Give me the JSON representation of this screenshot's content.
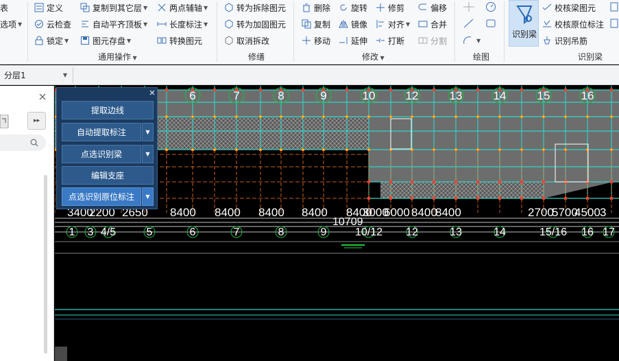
{
  "ribbon": {
    "col0": {
      "item1": "表",
      "item2": "选项"
    },
    "common_ops": {
      "define": "定义",
      "copy_to_other_layer": "复制到其它层",
      "two_point_axis": "两点辅轴",
      "cloud_check": "云检查",
      "auto_align_slab": "自动平齐顶板",
      "length_dim": "长度标注",
      "lock": "锁定",
      "element_save": "图元存盘",
      "convert_element": "转换图元",
      "group_label": "通用操作"
    },
    "repair": {
      "to_demolish": "转为拆除图元",
      "to_reinforce": "转为加固图元",
      "cancel_demolish": "取消拆改",
      "group_label": "修缮"
    },
    "modify": {
      "delete": "删除",
      "rotate": "旋转",
      "trim": "修剪",
      "offset": "偏移",
      "copy": "复制",
      "mirror": "镜像",
      "align": "对齐",
      "merge": "合并",
      "move": "移动",
      "extend": "延伸",
      "break": "打断",
      "split": "分割",
      "group_label": "修改"
    },
    "draw": {
      "group_label": "绘图"
    },
    "recognize_beam": {
      "main_label": "识别梁",
      "check_beam_elem": "校核梁图元",
      "check_origin_dim": "校核原位标注",
      "recognize_hanger": "识别吊筋",
      "group_label": "识别梁"
    }
  },
  "layer_selector": {
    "value": "分层1"
  },
  "float_panel": {
    "btn_extract_edge": "提取边线",
    "btn_auto_extract_dim": "自动提取标注",
    "btn_pick_recognize_beam": "点选识别梁",
    "btn_edit_support": "编辑支座",
    "btn_pick_origin_dim": "点选识别原位标注"
  },
  "drawing": {
    "top_axes": [
      "6",
      "7",
      "8",
      "9",
      "10",
      "12",
      "13",
      "14",
      "15",
      "16"
    ],
    "bottom_axes": [
      "1",
      "3",
      "4/5",
      "5",
      "6",
      "7",
      "8",
      "9",
      "10/12",
      "12",
      "13",
      "14",
      "15/16",
      "16",
      "17"
    ],
    "dims": [
      "3400",
      "2200",
      "2650",
      "8400",
      "8400",
      "8400",
      "8400",
      "8400",
      "3000",
      "6000",
      "8400",
      "8400",
      "2700",
      "5700",
      "4500",
      "3"
    ],
    "dim_total": "10709",
    "colors": {
      "grid_cyan": "#2fd6c8",
      "axis_green": "#21b24a",
      "beam_red": "#ff3b2f",
      "dim_white": "#ffffff",
      "slab_gray": "#6d6d6d"
    }
  }
}
